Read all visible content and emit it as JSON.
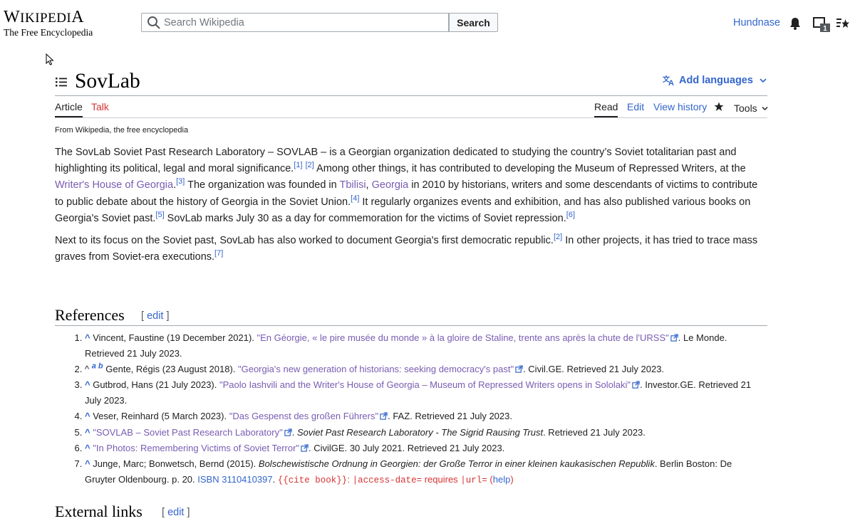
{
  "header": {
    "logo_wordmark": "Wikipedia",
    "logo_tagline": "The Free Encyclopedia",
    "search_placeholder": "Search Wikipedia",
    "search_button": "Search",
    "username": "Hundnase",
    "tray_count": "1"
  },
  "page": {
    "title": "SovLab",
    "add_languages": "Add languages",
    "tabs": {
      "article": "Article",
      "talk": "Talk",
      "read": "Read",
      "edit": "Edit",
      "history": "View history",
      "tools": "Tools"
    },
    "tagline": "From Wikipedia, the free encyclopedia"
  },
  "body": {
    "p1_a": "The SovLab Soviet Past Research Laboratory – SOVLAB – is a Georgian organization dedicated to studying the country’s Soviet totalitarian past and highlighting its political, legal and moral significance.",
    "p1_ref1": "[1]",
    "p1_ref2": "[2]",
    "p1_b": " Among other things, it has contributed to developing the Museum of Repressed Writers, at the ",
    "p1_link_house": "Writer's House of Georgia",
    "p1_ref3": "[3]",
    "p1_c": " The organization was founded in ",
    "p1_link_tbilisi": "Tbilisi",
    "p1_comma": ", ",
    "p1_link_georgia": "Georgia",
    "p1_d": " in 2010 by historians, writers and some descendants of victims to contribute to public debate about the history of Georgia in the Soviet Union.",
    "p1_ref4": "[4]",
    "p1_e": " It regularly organizes events and exhibition, and has also published various books on Georgia's Soviet past.",
    "p1_ref5": "[5]",
    "p1_f": " SovLab marks July 30 as a day for commemoration for the victims of Soviet repression.",
    "p1_ref6": "[6]",
    "p2_a": "Next to its focus on the Soviet past, SovLab has also worked to document Georgia's first democratic republic.",
    "p2_ref2": "[2]",
    "p2_b": " In other projects, it has tried to trace mass graves from Soviet-era executions.",
    "p2_ref7": "[7]"
  },
  "references": {
    "heading": "References",
    "edit_label": "edit",
    "caret": "^",
    "items": [
      {
        "pre": "Vincent, Faustine (19 December 2021). ",
        "link": "\"En Géorgie, « le pire musée du monde » à la gloire de Staline, trente ans après la chute de l'URSS\"",
        "post": ". Le Monde. Retrieved 21 July 2023."
      },
      {
        "backrefs": "a b",
        "pre": "Gente, Régis (23 August 2018). ",
        "link": "\"Georgia's new generation of historians: seeking democracy's past\"",
        "post": ". Civil.GE. Retrieved 21 July 2023."
      },
      {
        "pre": "Gutbrod, Hans (21 July 2023). ",
        "link": "\"Paolo Iashvili and the Writer's House of Georgia – Museum of Repressed Writers opens in Sololaki\"",
        "post": ". Investor.GE. Retrieved 21 July 2023."
      },
      {
        "pre": "Veser, Reinhard (5 March 2023). ",
        "link": "\"Das Gespenst des großen Führers\"",
        "post": ". FAZ. Retrieved 21 July 2023."
      },
      {
        "pre": "",
        "link": "\"SOVLAB – Soviet Past Research Laboratory\"",
        "post_a": ". ",
        "italic": "Soviet Past Research Laboratory - The Sigrid Rausing Trust",
        "post": ". Retrieved 21 July 2023."
      },
      {
        "pre": "",
        "link": "\"In Photos: Remembering Victims of Soviet Terror\"",
        "post": ". CivilGE. 30 July 2021. Retrieved 21 July 2023."
      },
      {
        "pre": "Junge, Marc; Bonwetsch, Bernd (2015). ",
        "italic": "Bolschewistische Ordnung in Georgien: der Große Terror in einer kleinen kaukasischen Republik",
        "post": ". Berlin Boston: De Gruyter Oldenbourg. p. 20. ",
        "isbn": "ISBN 3110410397",
        "cite_code": "{{cite book}}",
        "colon": ": ",
        "access_code": "|access-date=",
        "requires": " requires ",
        "url_code": "|url=",
        "open_paren": " (",
        "help": "help",
        "close_paren": ")"
      }
    ]
  },
  "external_links": {
    "heading": "External links",
    "edit_label": "edit"
  },
  "colors": {
    "link": "#3366cc",
    "visited": "#795cb2",
    "redlink": "#d73333",
    "text": "#202122"
  },
  "icons": [
    "search-icon",
    "bell-icon",
    "notices-tray-icon",
    "watchlist-icon",
    "toc-icon",
    "translate-icon",
    "star-icon",
    "external-link-icon",
    "cursor-icon"
  ]
}
